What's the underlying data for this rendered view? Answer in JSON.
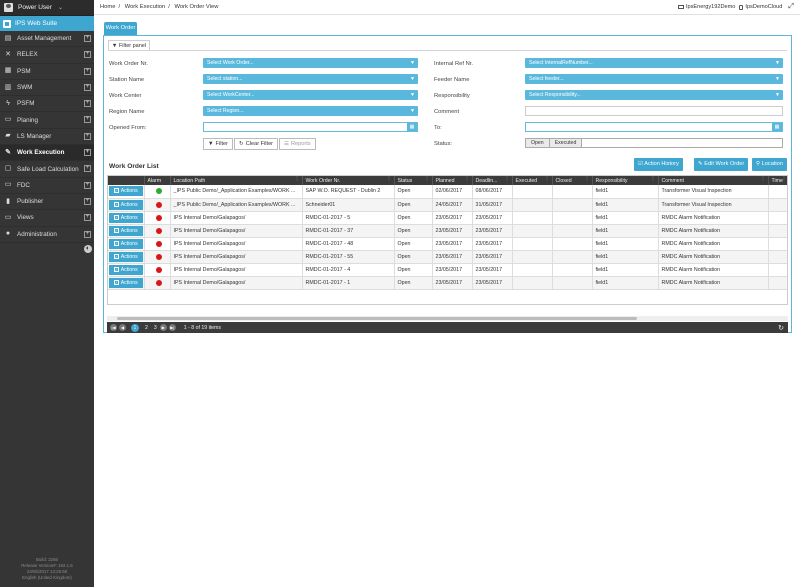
{
  "sidebar": {
    "user": "Power User",
    "brand": "IPS Web Suite",
    "items": [
      {
        "label": "Asset Management",
        "icon": "layers-icon",
        "glyph": "▤"
      },
      {
        "label": "RELEX",
        "icon": "shuffle-icon",
        "glyph": "✕"
      },
      {
        "label": "PSM",
        "icon": "stack-icon",
        "glyph": "▦"
      },
      {
        "label": "SWM",
        "icon": "boxes-icon",
        "glyph": "▥"
      },
      {
        "label": "PSFM",
        "icon": "bolt-icon",
        "glyph": "ϟ"
      },
      {
        "label": "Planing",
        "icon": "calendar-icon",
        "glyph": "▭"
      },
      {
        "label": "LS Manager",
        "icon": "chart-icon",
        "glyph": "▰"
      },
      {
        "label": "Work Execution",
        "icon": "wrench-icon",
        "glyph": "✎"
      },
      {
        "label": "Safe Load Calculation",
        "icon": "calculator-icon",
        "glyph": "▢"
      },
      {
        "label": "FDC",
        "icon": "folder-icon",
        "glyph": "▭"
      },
      {
        "label": "Publisher",
        "icon": "book-icon",
        "glyph": "▮"
      },
      {
        "label": "Views",
        "icon": "eye-icon",
        "glyph": "▭"
      },
      {
        "label": "Administration",
        "icon": "user-icon",
        "glyph": "●"
      }
    ],
    "footer": [
      "Build: 2266",
      "Release Version#: 192.1.6",
      "23/05/2017 13:26:58",
      "English (United Kingdom)"
    ]
  },
  "topbar": {
    "breadcrumb": [
      "Home",
      "Work Execution",
      "Work Order View"
    ],
    "server": "IpsEnergy192Demo",
    "cloud": "IpsDemoCloud"
  },
  "tab": "Work Order",
  "filter": {
    "tab": "Filter panel",
    "labels": {
      "wo_nr": "Work Order Nr.",
      "station": "Station Name",
      "work_center": "Work Center",
      "region": "Region Name",
      "opened_from": "Opened From:",
      "internal_ref": "Internal Ref Nr.",
      "feeder": "Feeder Name",
      "responsibility": "Responsibility",
      "comment": "Comment",
      "to": "To:",
      "status": "Status:"
    },
    "selects": {
      "wo_nr": "Select Work Order...",
      "station": "Select station...",
      "work_center": "Select WorkCenter...",
      "region": "Select Region...",
      "internal_ref": "Select InternalRefNumber...",
      "feeder": "Select feeder...",
      "responsibility": "Select Responsibility..."
    },
    "status_options": [
      "Open",
      "Executed"
    ],
    "buttons": {
      "filter": "Filter",
      "clear": "Clear Filter",
      "reports": "Reports"
    }
  },
  "list": {
    "title": "Work Order List",
    "buttons": {
      "history": "Action History",
      "edit": "Edit Work Order",
      "location": "Location"
    },
    "columns": [
      "",
      "Alarm",
      "Location Path",
      "Work Order Nr.",
      "Status",
      "Planned",
      "Deadlin...",
      "Executed",
      "Closed",
      "Responsibility",
      "Comment",
      "Time"
    ],
    "action_label": "Actions",
    "rows": [
      {
        "alarm": "green",
        "path": "_IPS Public Demo/_Application Examples/WORK ...",
        "wo": "SAP W.O. REQUEST - Dublin 2",
        "status": "Open",
        "planned": "02/06/2017",
        "deadline": "08/06/2017",
        "executed": "",
        "closed": "",
        "resp": "field1",
        "comment": "Transformer Visual Inspection"
      },
      {
        "alarm": "red",
        "path": "_IPS Public Demo/_Application Examples/WORK ...",
        "wo": "Schneider01",
        "status": "Open",
        "planned": "24/05/2017",
        "deadline": "31/05/2017",
        "executed": "",
        "closed": "",
        "resp": "field1",
        "comment": "Transformer Visual Inspection"
      },
      {
        "alarm": "red",
        "path": "IPS Internal Demo/Galapagos/",
        "wo": "RMDC-01-2017 - 5",
        "status": "Open",
        "planned": "23/05/2017",
        "deadline": "23/05/2017",
        "executed": "",
        "closed": "",
        "resp": "field1",
        "comment": "RMDC Alarm Notification"
      },
      {
        "alarm": "red",
        "path": "IPS Internal Demo/Galapagos/",
        "wo": "RMDC-01-2017 - 37",
        "status": "Open",
        "planned": "23/05/2017",
        "deadline": "23/05/2017",
        "executed": "",
        "closed": "",
        "resp": "field1",
        "comment": "RMDC Alarm Notification"
      },
      {
        "alarm": "red",
        "path": "IPS Internal Demo/Galapagos/",
        "wo": "RMDC-01-2017 - 48",
        "status": "Open",
        "planned": "23/05/2017",
        "deadline": "23/05/2017",
        "executed": "",
        "closed": "",
        "resp": "field1",
        "comment": "RMDC Alarm Notification"
      },
      {
        "alarm": "red",
        "path": "IPS Internal Demo/Galapagos/",
        "wo": "RMDC-01-2017 - 55",
        "status": "Open",
        "planned": "23/05/2017",
        "deadline": "23/05/2017",
        "executed": "",
        "closed": "",
        "resp": "field1",
        "comment": "RMDC Alarm Notification"
      },
      {
        "alarm": "red",
        "path": "IPS Internal Demo/Galapagos/",
        "wo": "RMDC-01-2017 - 4",
        "status": "Open",
        "planned": "23/05/2017",
        "deadline": "23/05/2017",
        "executed": "",
        "closed": "",
        "resp": "field1",
        "comment": "RMDC Alarm Notification"
      },
      {
        "alarm": "red",
        "path": "IPS Internal Demo/Galapagos/",
        "wo": "RMDC-01-2017 - 1",
        "status": "Open",
        "planned": "23/05/2017",
        "deadline": "23/05/2017",
        "executed": "",
        "closed": "",
        "resp": "field1",
        "comment": "RMDC Alarm Notification"
      }
    ],
    "pager": {
      "pages": [
        "1",
        "2",
        "3"
      ],
      "current": "1",
      "info": "1 - 8 of 19 items"
    }
  },
  "colors": {
    "accent": "#3fa6cf",
    "sidebar": "#353535",
    "alarm_green": "#2eab2e",
    "alarm_red": "#d9171b"
  }
}
